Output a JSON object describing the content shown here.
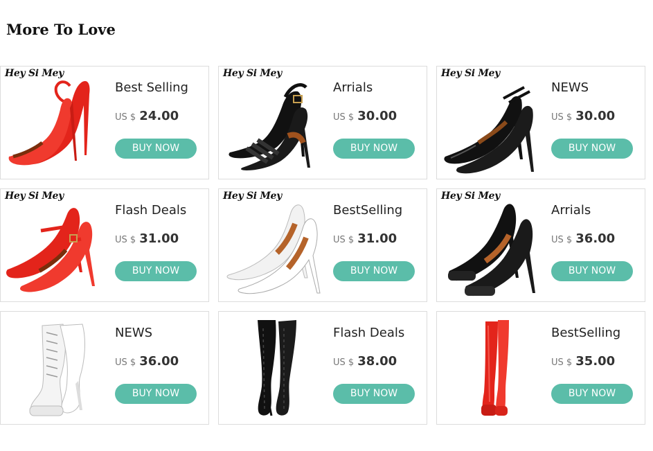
{
  "section": {
    "title": "More To Love"
  },
  "products": [
    {
      "brand": "Hey Si Mey",
      "title": "Best Selling",
      "currency": "US $",
      "price": "24.00",
      "button": "BUY NOW",
      "shoe": "red-slingback-sandal-icon",
      "color": "#e3241b"
    },
    {
      "brand": "Hey Si Mey",
      "title": "Arrials",
      "currency": "US $",
      "price": "30.00",
      "button": "BUY NOW",
      "shoe": "black-strappy-sandal-icon",
      "color": "#111111"
    },
    {
      "brand": "Hey Si Mey",
      "title": "NEWS",
      "currency": "US $",
      "price": "30.00",
      "button": "BUY NOW",
      "shoe": "black-ankle-strap-pump-icon",
      "color": "#111111"
    },
    {
      "brand": "Hey Si Mey",
      "title": "Flash Deals",
      "currency": "US $",
      "price": "31.00",
      "button": "BUY NOW",
      "shoe": "red-mary-jane-pump-icon",
      "color": "#e3241b"
    },
    {
      "brand": "Hey Si Mey",
      "title": "BestSelling",
      "currency": "US $",
      "price": "31.00",
      "button": "BUY NOW",
      "shoe": "white-pointed-pump-icon",
      "color": "#f2f2f2"
    },
    {
      "brand": "Hey Si Mey",
      "title": "Arrials",
      "currency": "US $",
      "price": "36.00",
      "button": "BUY NOW",
      "shoe": "black-platform-pump-icon",
      "color": "#111111"
    },
    {
      "brand": "",
      "title": "NEWS",
      "currency": "US $",
      "price": "36.00",
      "button": "BUY NOW",
      "shoe": "white-lace-up-platform-boot-icon",
      "color": "#f4f4f4"
    },
    {
      "brand": "",
      "title": "Flash Deals",
      "currency": "US $",
      "price": "38.00",
      "button": "BUY NOW",
      "shoe": "black-thigh-high-boot-icon",
      "color": "#111111"
    },
    {
      "brand": "",
      "title": "BestSelling",
      "currency": "US $",
      "price": "35.00",
      "button": "BUY NOW",
      "shoe": "red-over-knee-platform-boot-icon",
      "color": "#e3241b"
    }
  ],
  "accent": "#5bbda9"
}
